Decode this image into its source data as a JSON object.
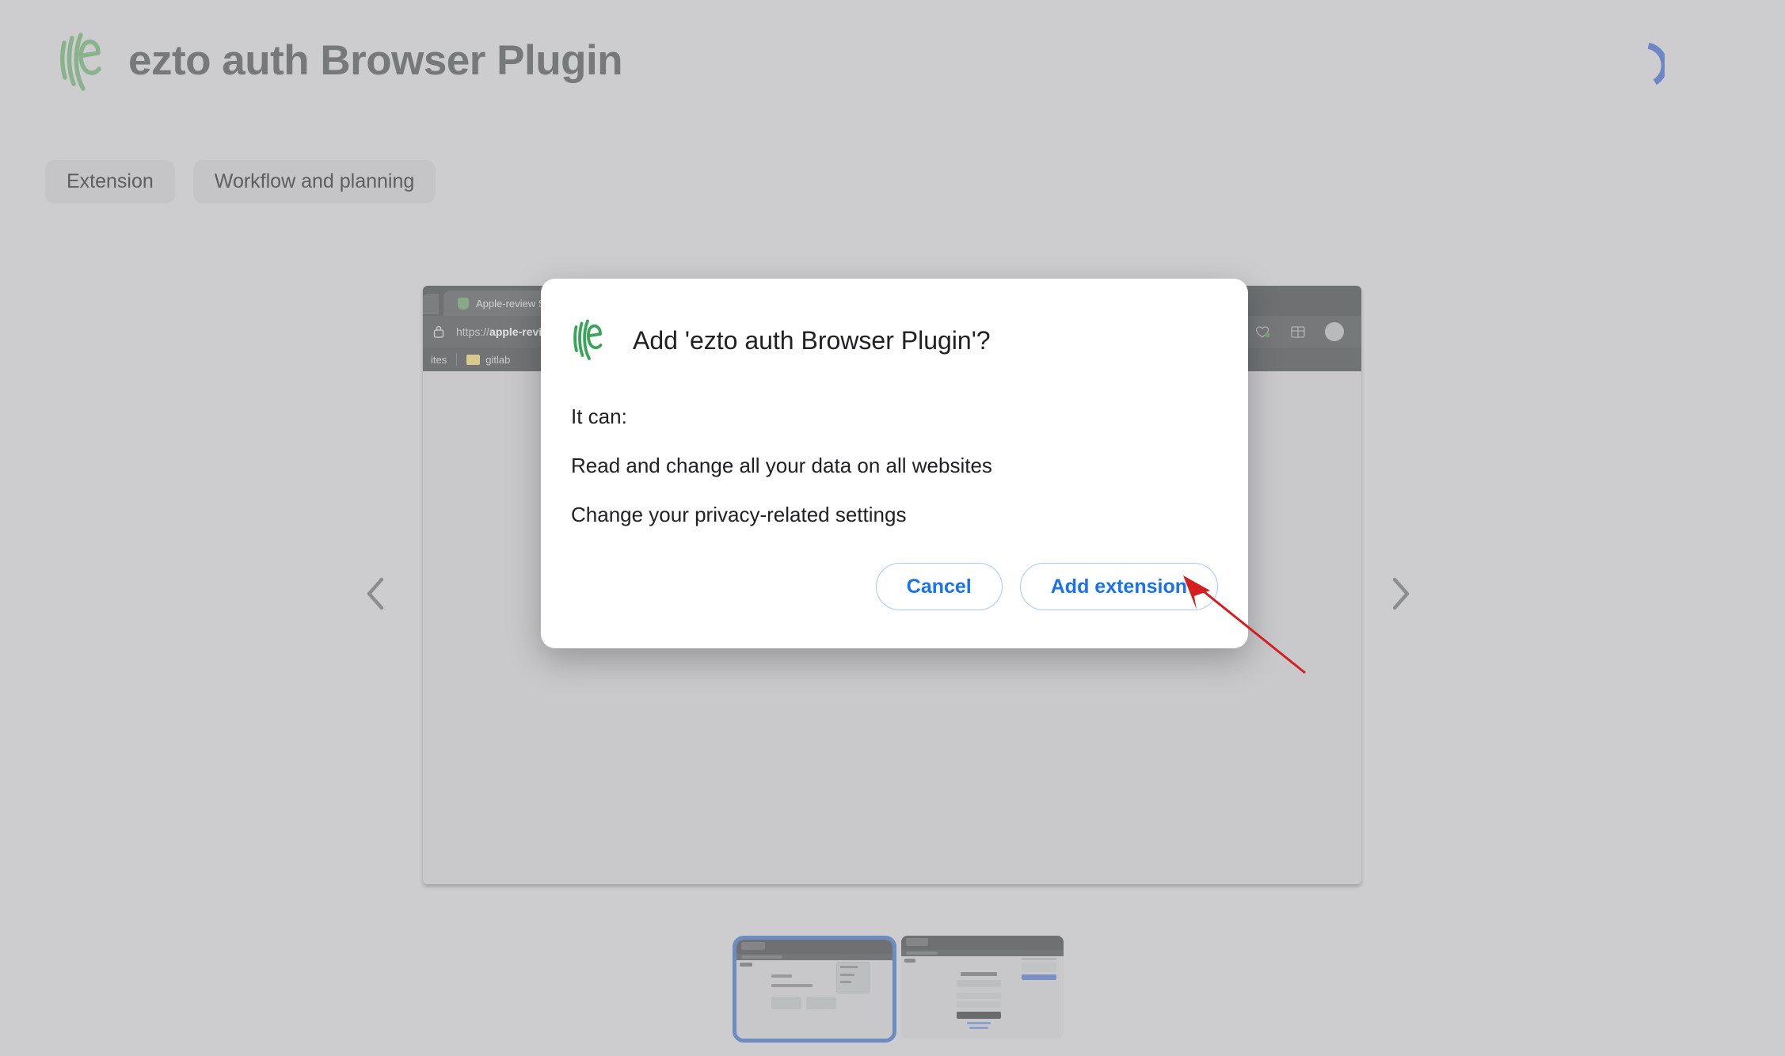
{
  "header": {
    "title": "ezto auth Browser Plugin",
    "logo_icon": "ezto-logo-icon",
    "logo_color": "#8ab38d",
    "spinner_icon": "loading-spinner-icon",
    "spinner_color": "#6d87c4"
  },
  "chips": [
    {
      "label": "Extension"
    },
    {
      "label": "Workflow and planning"
    }
  ],
  "carousel": {
    "prev_icon": "chevron-left-icon",
    "next_icon": "chevron-right-icon",
    "screenshot": {
      "browser": {
        "tab_title": "Apple-review SSO",
        "tab_favicon": "shield-icon",
        "lock_icon": "lock-icon",
        "url_prefix": "https://",
        "url_host": "apple-review.qa.ez",
        "bookmarks": [
          {
            "label": "ites",
            "icon": "bookmark-text"
          },
          {
            "label": "gitlab",
            "icon": "folder-icon"
          }
        ],
        "toolbar_icons": [
          "star-icon",
          "collections-icon",
          "favorites-heart-icon",
          "extensions-puzzle-icon",
          "profile-avatar-icon"
        ]
      }
    },
    "thumbnails": [
      {
        "name": "thumbnail-1",
        "selected": true
      },
      {
        "name": "thumbnail-2",
        "selected": false
      }
    ]
  },
  "dialog": {
    "logo_icon": "ezto-logo-icon",
    "logo_color": "#3ba35a",
    "title": "Add 'ezto auth Browser Plugin'?",
    "permissions_intro": "It can:",
    "permissions": [
      "Read and change all your data on all websites",
      "Change your privacy-related settings"
    ],
    "cancel_label": "Cancel",
    "confirm_label": "Add extension",
    "accent_color": "#1a73e8",
    "border_color": "#a6c8fb"
  },
  "annotation": {
    "arrow_icon": "red-arrow-icon",
    "arrow_color": "#d41f1f",
    "points_to": "Add extension"
  }
}
